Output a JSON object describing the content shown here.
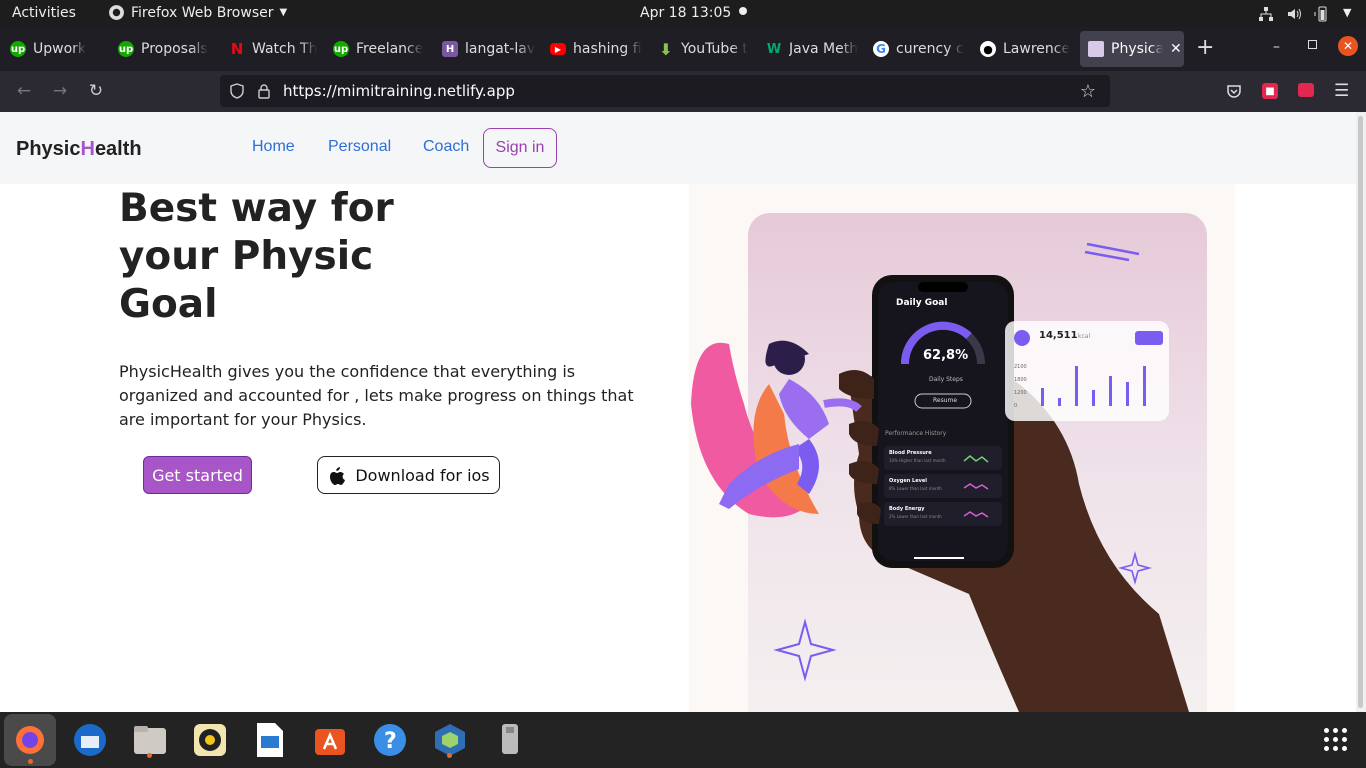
{
  "topbar": {
    "activities": "Activities",
    "app_name": "Firefox Web Browser",
    "clock": "Apr 18  13:05"
  },
  "tabs": [
    {
      "label": "Upwork",
      "icon": "upwork-icon"
    },
    {
      "label": "Proposals",
      "icon": "upwork-icon"
    },
    {
      "label": "Watch Th",
      "icon": "netflix-icon"
    },
    {
      "label": "Freelance",
      "icon": "upwork-icon"
    },
    {
      "label": "langat-lav",
      "icon": "heroku-icon"
    },
    {
      "label": "hashing fi",
      "icon": "youtube-icon"
    },
    {
      "label": "YouTube t",
      "icon": "download-icon"
    },
    {
      "label": "Java Meth",
      "icon": "w3-icon"
    },
    {
      "label": "curency c",
      "icon": "google-icon"
    },
    {
      "label": "Lawrence",
      "icon": "github-icon"
    },
    {
      "label": "Physical",
      "icon": "site-icon",
      "active": true
    }
  ],
  "url": "https://mimitraining.netlify.app",
  "site": {
    "brand_a": "Physic",
    "brand_b": "H",
    "brand_c": "ealth",
    "nav": [
      "Home",
      "Personal",
      "Coach"
    ],
    "signin": "Sign in",
    "hero_title": "Best way for your Physic Goal",
    "hero_desc": "PhysicHealth gives you the confidence that everything is organized and accounted for , lets make progress on things that are important for your Physics.",
    "cta_primary": "Get started",
    "cta_secondary": "Download for ios"
  },
  "phone": {
    "header": "Daily Goal",
    "percent": "62,8%",
    "steps_label": "Daily Steps",
    "resume": "Resume",
    "history_title": "Performance History",
    "metrics": [
      {
        "name": "Blood Pressure",
        "sub": "10% Higher than last month"
      },
      {
        "name": "Oxygen Level",
        "sub": "8% Lower than last month"
      },
      {
        "name": "Body Energy",
        "sub": "2% Lower than last month"
      }
    ]
  },
  "kcal_card": {
    "value": "14,511",
    "unit": "kcal",
    "ticks": [
      "2100",
      "1800",
      "1200",
      "0"
    ]
  },
  "colors": {
    "accent": "#a855c8",
    "link": "#2d6fd6",
    "phone_purple": "#7b5cf0"
  }
}
